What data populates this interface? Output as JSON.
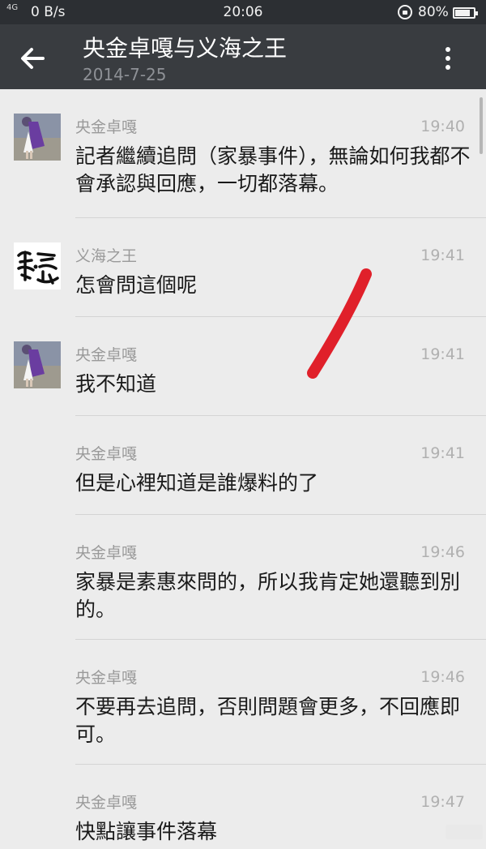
{
  "status_bar": {
    "network": "4G",
    "speed": "0 B/s",
    "time": "20:06",
    "battery_percent": "80%",
    "battery_level": 0.8
  },
  "header": {
    "title": "央金卓嘎与义海之王",
    "date": "2014-7-25"
  },
  "messages": [
    {
      "sender": "央金卓嘎",
      "time": "19:40",
      "text": "記者繼續追問（家暴事件），無論如何我都不會承認與回應，一切都落幕。",
      "avatar": "girl-photo"
    },
    {
      "sender": "义海之王",
      "time": "19:41",
      "text": "怎會問這個呢",
      "avatar": "calligraphy-logo"
    },
    {
      "sender": "央金卓嘎",
      "time": "19:41",
      "text": "我不知道",
      "avatar": "girl-photo"
    },
    {
      "sender": "央金卓嘎",
      "time": "19:41",
      "text": "但是心裡知道是誰爆料的了"
    },
    {
      "sender": "央金卓嘎",
      "time": "19:46",
      "text": "家暴是素惠來問的，所以我肯定她還聽到別的。"
    },
    {
      "sender": "央金卓嘎",
      "time": "19:46",
      "text": "不要再去追問，否則問題會更多，不回應即可。"
    },
    {
      "sender": "央金卓嘎",
      "time": "19:47",
      "text": "快點讓事件落幕"
    }
  ],
  "colors": {
    "status_bar_bg": "#2c2f33",
    "app_bar_bg": "#393c40",
    "chat_bg": "#ececec",
    "annotation_stroke": "#e0202a"
  }
}
